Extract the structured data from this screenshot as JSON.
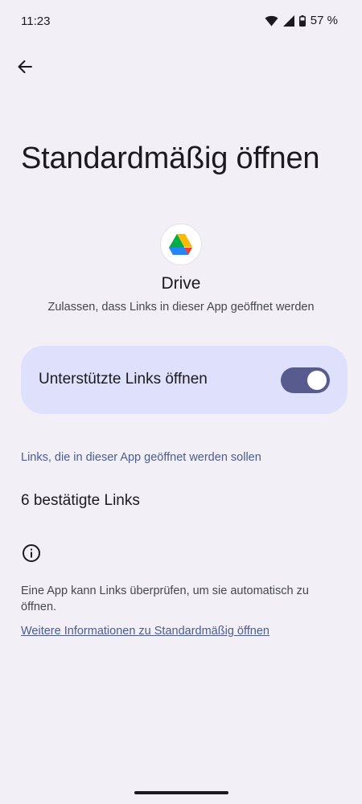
{
  "status_bar": {
    "time": "11:23",
    "battery": "57 %",
    "icons": [
      "wifi-icon",
      "cellular-signal-icon",
      "battery-icon"
    ]
  },
  "header": {
    "back_icon": "arrow-back-icon",
    "title": "Standardmäßig öffnen"
  },
  "app": {
    "icon": "google-drive-icon",
    "name": "Drive",
    "subtitle": "Zulassen, dass Links in dieser App geöffnet werden"
  },
  "toggle": {
    "label": "Unterstützte Links öffnen",
    "state": "on"
  },
  "links_section": {
    "header": "Links, die in dieser App geöffnet werden sollen",
    "verified_links": "6 bestätigte Links"
  },
  "info": {
    "icon": "info-icon",
    "text": "Eine App kann Links überprüfen, um sie automatisch zu öffnen.",
    "link": "Weitere Informationen zu Standardmäßig öffnen"
  },
  "colors": {
    "background": "#f2eff6",
    "card": "#dfe0fb",
    "switch_track": "#575b8d",
    "accent_text": "#4b5c92"
  }
}
